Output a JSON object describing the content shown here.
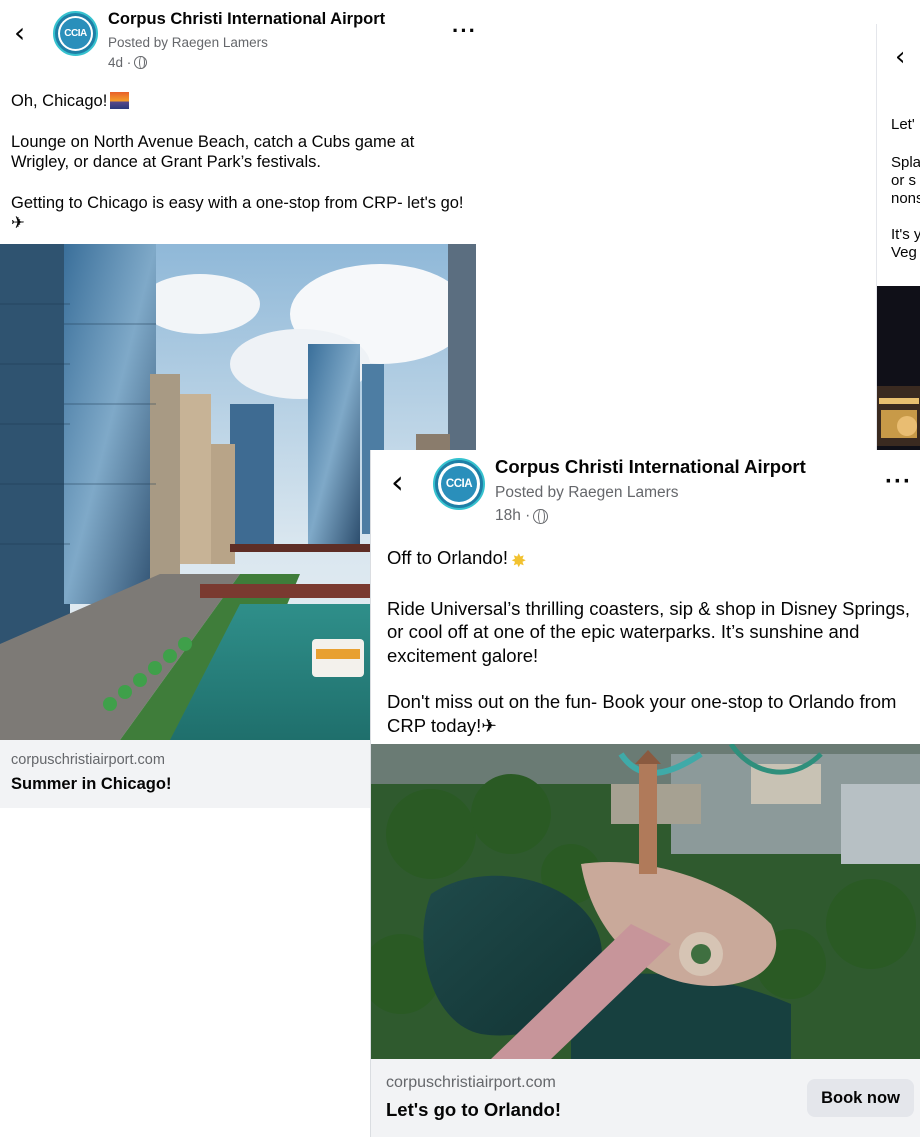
{
  "post_left": {
    "page_name": "Corpus Christi International Airport",
    "posted_by": "Posted by Raegen Lamers",
    "time": "4d ·",
    "avatar_text": "CCIA",
    "body": [
      "Oh, Chicago!",
      "Lounge on North Avenue Beach, catch a Cubs game at Wrigley, or dance at Grant Park’s festivals.",
      "Getting to Chicago is easy with a one-stop from CRP- let's go!"
    ],
    "link_domain": "corpuschristiairport.com",
    "link_title": "Summer in Chicago!"
  },
  "post_front": {
    "page_name": "Corpus Christi International Airport",
    "posted_by": "Posted by Raegen Lamers",
    "time": "18h ·",
    "avatar_text": "CCIA",
    "body": [
      "Off to Orlando!",
      "Ride Universal’s thrilling coasters, sip & shop in Disney Springs, or cool off at one of the epic waterparks. It’s sunshine and excitement galore!",
      "Don't miss out on the fun- Book your one-stop to Orlando from CRP today!"
    ],
    "link_domain": "corpuschristiairport.com",
    "link_title": "Let's go to Orlando!",
    "cta_label": "Book now"
  },
  "post_right": {
    "lines": [
      "Let'",
      "Spla",
      "or s",
      "nons",
      "It's y",
      "Veg"
    ]
  },
  "icons": {
    "back": "chevron-left-icon",
    "more": "more-horizontal-icon",
    "globe": "globe-icon",
    "sunset_emoji": "sunset-emoji-icon",
    "sparkle_emoji": "sparkle-emoji-icon",
    "plane": "airplane-icon"
  },
  "colors": {
    "avatar_blue": "#2a8fbb",
    "avatar_ring": "#36c2cf",
    "link_bar": "#f2f3f5",
    "cta_bg": "#e4e6eb"
  }
}
